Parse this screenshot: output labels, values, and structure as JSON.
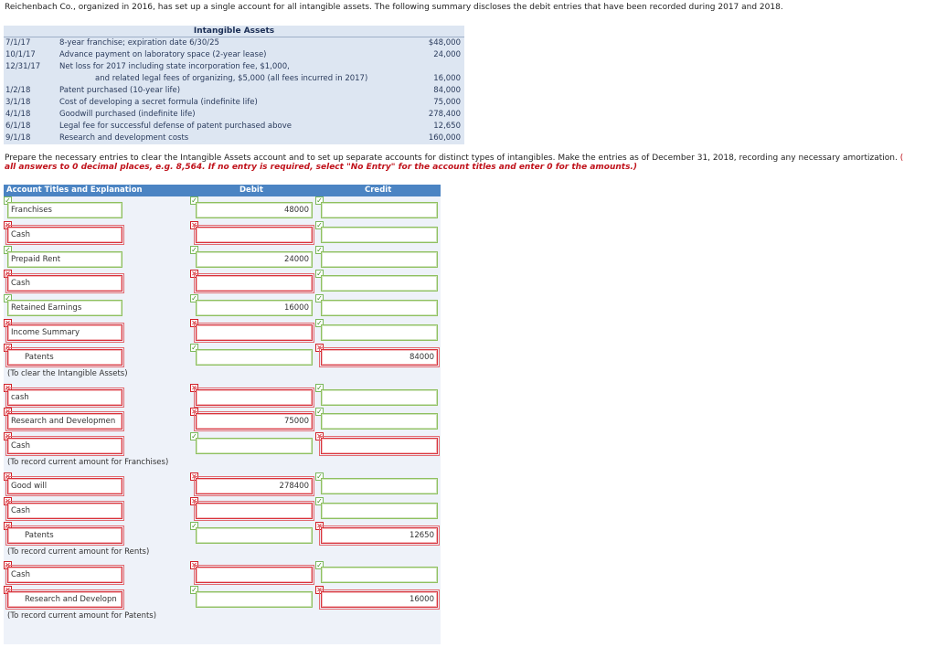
{
  "intro": "Reichenbach Co., organized in 2016, has set up a single account for all intangible assets. The following summary discloses the debit entries that have been recorded during 2017 and 2018.",
  "intangible_table": {
    "title": "Intangible Assets",
    "rows": [
      {
        "date": "7/1/17",
        "desc": "8-year franchise; expiration date 6/30/25",
        "amount": "$48,000"
      },
      {
        "date": "10/1/17",
        "desc": "Advance payment on laboratory space (2-year lease)",
        "amount": "24,000"
      },
      {
        "date": "12/31/17",
        "desc": "Net loss for 2017 including state incorporation fee, $1,000,",
        "amount": ""
      },
      {
        "date": "",
        "desc": "and related legal fees of organizing, $5,000 (all fees incurred in 2017)",
        "amount": "16,000"
      },
      {
        "date": "1/2/18",
        "desc": "Patent purchased (10-year life)",
        "amount": "84,000"
      },
      {
        "date": "3/1/18",
        "desc": "Cost of developing a secret formula (indefinite life)",
        "amount": "75,000"
      },
      {
        "date": "4/1/18",
        "desc": "Goodwill purchased (indefinite life)",
        "amount": "278,400"
      },
      {
        "date": "6/1/18",
        "desc": "Legal fee for successful defense of patent purchased above",
        "amount": "12,650"
      },
      {
        "date": "9/1/18",
        "desc": "Research and development costs",
        "amount": "160,000"
      }
    ]
  },
  "instructions": {
    "text": "Prepare the necessary entries to clear the Intangible Assets account and to set up separate accounts for distinct types of intangibles. Make the entries as of December 31, 2018, recording any necessary amortization.",
    "paren_open": "(",
    "rounding_note": "all answers to 0 decimal places, e.g. 8,564. If no entry is required, select \"No Entry\" for the account titles and enter 0 for the amounts.)"
  },
  "journal": {
    "headers": {
      "account": "Account Titles and Explanation",
      "debit": "Debit",
      "credit": "Credit"
    },
    "lines": [
      {
        "account": "Franchises",
        "account_status": "ok",
        "debit": "48000",
        "debit_status": "ok",
        "credit": "",
        "credit_status": "ok"
      },
      {
        "account": "Cash",
        "account_status": "bad",
        "debit": "",
        "debit_status": "bad",
        "credit": "",
        "credit_status": "ok"
      },
      {
        "account": "Prepaid Rent",
        "account_status": "ok",
        "debit": "24000",
        "debit_status": "ok",
        "credit": "",
        "credit_status": "ok"
      },
      {
        "account": "Cash",
        "account_status": "bad",
        "debit": "",
        "debit_status": "bad",
        "credit": "",
        "credit_status": "ok"
      },
      {
        "account": "Retained Earnings",
        "account_status": "ok",
        "debit": "16000",
        "debit_status": "ok",
        "credit": "",
        "credit_status": "ok"
      },
      {
        "account": "Income Summary",
        "account_status": "bad",
        "debit": "",
        "debit_status": "bad",
        "credit": "",
        "credit_status": "ok"
      },
      {
        "account": "Patents",
        "account_status": "bad",
        "debit": "",
        "debit_status": "ok",
        "credit": "84000",
        "credit_status": "bad",
        "memo": "(To clear the Intangible Assets)"
      },
      {
        "account": "cash",
        "account_status": "bad",
        "debit": "",
        "debit_status": "bad",
        "credit": "",
        "credit_status": "ok"
      },
      {
        "account": "Research and Developmen",
        "account_status": "bad",
        "debit": "75000",
        "debit_status": "bad",
        "credit": "",
        "credit_status": "ok"
      },
      {
        "account": "Cash",
        "account_status": "bad",
        "debit": "",
        "debit_status": "ok",
        "credit": "",
        "credit_status": "bad",
        "memo": "(To record current amount for Franchises)"
      },
      {
        "account": "Good will",
        "account_status": "bad",
        "debit": "278400",
        "debit_status": "bad",
        "credit": "",
        "credit_status": "ok"
      },
      {
        "account": "Cash",
        "account_status": "bad",
        "debit": "",
        "debit_status": "bad",
        "credit": "",
        "credit_status": "ok"
      },
      {
        "account": "Patents",
        "account_status": "bad",
        "debit": "",
        "debit_status": "ok",
        "credit": "12650",
        "credit_status": "bad",
        "memo": "(To record current amount for Rents)"
      },
      {
        "account": "Cash",
        "account_status": "bad",
        "debit": "",
        "debit_status": "bad",
        "credit": "",
        "credit_status": "ok"
      },
      {
        "account": "Research and Developn",
        "account_status": "bad",
        "debit": "",
        "debit_status": "ok",
        "credit": "16000",
        "credit_status": "bad",
        "memo": "(To record current amount for Patents)"
      }
    ]
  },
  "marks": {
    "ok": "✓",
    "bad": "✕"
  },
  "colors": {
    "header_blue": "#4b84c3",
    "table_bg": "#dde6f2",
    "error_red": "#d11f27",
    "ok_green": "#3f8f22"
  }
}
